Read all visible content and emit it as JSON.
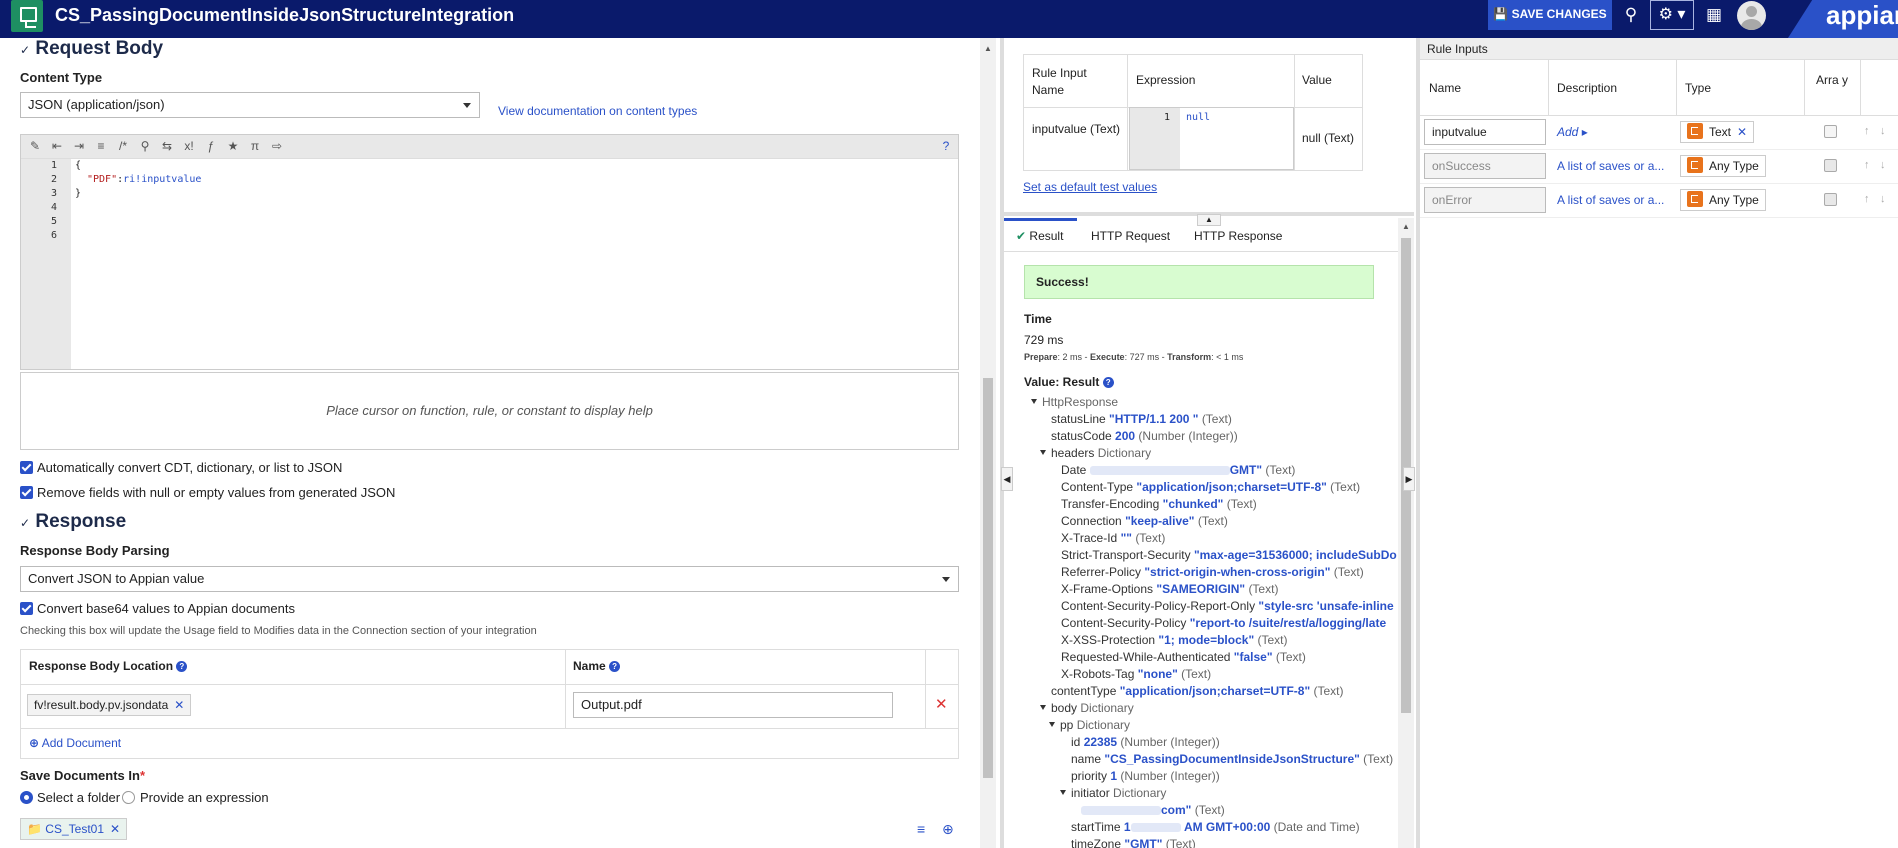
{
  "header": {
    "title": "CS_PassingDocumentInsideJsonStructureIntegration",
    "save_label": "SAVE CHANGES",
    "brand": "appian"
  },
  "request": {
    "section_title": "Request Body",
    "content_type_label": "Content Type",
    "content_type_value": "JSON (application/json)",
    "doc_link": "View documentation on content types",
    "code_lines": [
      "1",
      "2",
      "3",
      "4",
      "5",
      "6"
    ],
    "code": {
      "l1": "{",
      "l2_key": "\"PDF\"",
      "l2_colon": ":",
      "l2_val": "ri!inputvalue",
      "l3": "}"
    },
    "help_text": "Place cursor on function, rule, or constant to display help",
    "auto_convert": "Automatically convert CDT, dictionary, or list to JSON",
    "remove_null": "Remove fields with null or empty values from generated JSON"
  },
  "response": {
    "section_title": "Response",
    "parsing_label": "Response Body Parsing",
    "parsing_value": "Convert JSON to Appian value",
    "base64_label": "Convert base64 values to Appian documents",
    "base64_hint": "Checking this box will update the Usage field to Modifies data in the Connection section of your integration",
    "col_location": "Response Body Location",
    "col_name": "Name",
    "row_location": "fv!result.body.pv.jsondata",
    "row_name": "Output.pdf",
    "add_document": "Add Document",
    "save_in_label": "Save Documents In",
    "radio_folder": "Select a folder",
    "radio_expr": "Provide an expression",
    "folder_chip": "CS_Test01"
  },
  "test_inputs": {
    "col_name": "Rule Input Name",
    "col_expr": "Expression",
    "col_value": "Value",
    "row_name": "inputvalue (Text)",
    "row_ln": "1",
    "row_expr": "null",
    "row_value": "null (Text)",
    "default_link": "Set as default test values"
  },
  "result": {
    "tabs": [
      "Result",
      "HTTP Request",
      "HTTP Response"
    ],
    "success": "Success!",
    "time_label": "Time",
    "time_value": "729 ms",
    "prepare_label": "Prepare",
    "prepare_value": ": 2 ms - ",
    "execute_label": "Execute",
    "execute_value": ": 727 ms - ",
    "transform_label": "Transform",
    "transform_value": ": < 1 ms",
    "value_label": "Value: Result",
    "tree": {
      "root": "HttpResponse",
      "statusLine_k": "statusLine",
      "statusLine_v": "\"HTTP/1.1 200 \"",
      "statusLine_t": "(Text)",
      "statusCode_k": "statusCode",
      "statusCode_v": "200",
      "statusCode_t": "(Number (Integer))",
      "headers_k": "headers",
      "headers_t": "Dictionary",
      "date_k": "Date",
      "date_v": "GMT\"",
      "date_t": "(Text)",
      "ct_k": "Content-Type",
      "ct_v": "\"application/json;charset=UTF-8\"",
      "ct_t": "(Text)",
      "te_k": "Transfer-Encoding",
      "te_v": "\"chunked\"",
      "te_t": "(Text)",
      "conn_k": "Connection",
      "conn_v": "\"keep-alive\"",
      "conn_t": "(Text)",
      "trace_k": "X-Trace-Id",
      "trace_v": "\"\"",
      "trace_t": "(Text)",
      "sts_k": "Strict-Transport-Security",
      "sts_v": "\"max-age=31536000; includeSubDo",
      "rp_k": "Referrer-Policy",
      "rp_v": "\"strict-origin-when-cross-origin\"",
      "rp_t": "(Text)",
      "xfo_k": "X-Frame-Options",
      "xfo_v": "\"SAMEORIGIN\"",
      "xfo_t": "(Text)",
      "cspro_k": "Content-Security-Policy-Report-Only",
      "cspro_v": "\"style-src 'unsafe-inline",
      "csp_k": "Content-Security-Policy",
      "csp_v": "\"report-to /suite/rest/a/logging/late",
      "xss_k": "X-XSS-Protection",
      "xss_v": "\"1; mode=block\"",
      "xss_t": "(Text)",
      "rwa_k": "Requested-While-Authenticated",
      "rwa_v": "\"false\"",
      "rwa_t": "(Text)",
      "xrt_k": "X-Robots-Tag",
      "xrt_v": "\"none\"",
      "xrt_t": "(Text)",
      "ctype_k": "contentType",
      "ctype_v": "\"application/json;charset=UTF-8\"",
      "ctype_t": "(Text)",
      "body_k": "body",
      "body_t": "Dictionary",
      "pp_k": "pp",
      "pp_t": "Dictionary",
      "id_k": "id",
      "id_v": "22385",
      "id_t": "(Number (Integer))",
      "name_k": "name",
      "name_v": "\"CS_PassingDocumentInsideJsonStructure\"",
      "name_t": "(Text)",
      "prio_k": "priority",
      "prio_v": "1",
      "prio_t": "(Number (Integer))",
      "init_k": "initiator",
      "init_t": "Dictionary",
      "email_v": "com\"",
      "email_t": "(Text)",
      "start_k": "startTime",
      "start_v1": "1",
      "start_v2": "AM GMT+00:00",
      "start_t": "(Date and Time)",
      "tz_k": "timeZone",
      "tz_v": "\"GMT\"",
      "tz_t": "(Text)"
    }
  },
  "rule_inputs": {
    "title": "Rule Inputs",
    "col_name": "Name",
    "col_desc": "Description",
    "col_type": "Type",
    "col_array": "Arra y",
    "rows": [
      {
        "name": "inputvalue",
        "desc": "Add",
        "type": "Text"
      },
      {
        "name": "onSuccess",
        "desc": "A list of saves or a...",
        "type": "Any Type"
      },
      {
        "name": "onError",
        "desc": "A list of saves or a...",
        "type": "Any Type"
      }
    ]
  }
}
